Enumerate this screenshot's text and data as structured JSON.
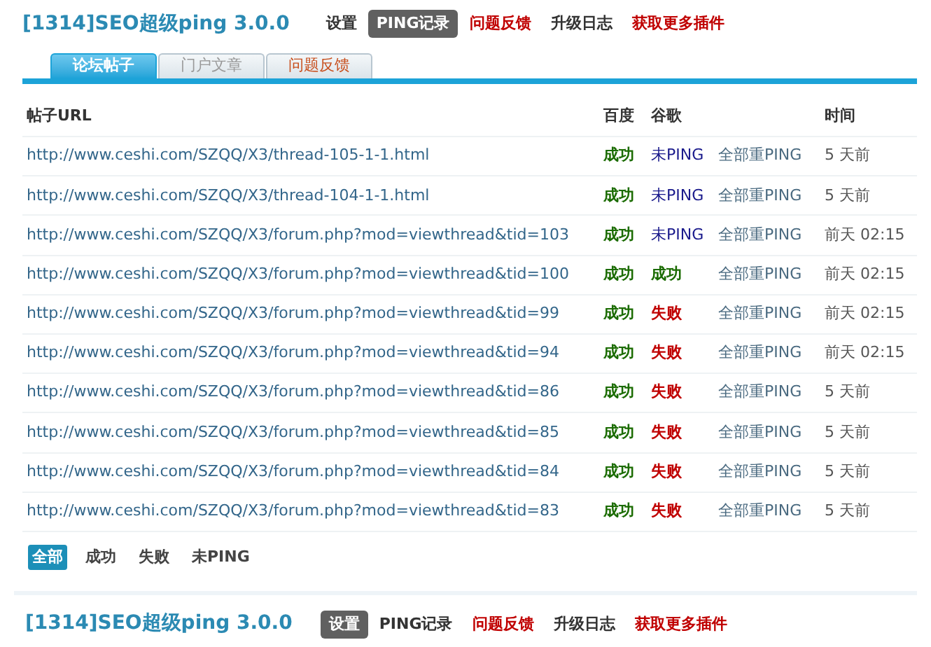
{
  "header": {
    "title": "[1314]SEO超级ping 3.0.0",
    "nav": [
      {
        "label": "设置",
        "selected": false,
        "kind": "plain"
      },
      {
        "label": "PING记录",
        "selected": true,
        "kind": "plain"
      },
      {
        "label": "问题反馈",
        "selected": false,
        "kind": "alert"
      },
      {
        "label": "升级日志",
        "selected": false,
        "kind": "plain"
      },
      {
        "label": "获取更多插件",
        "selected": false,
        "kind": "alert"
      }
    ]
  },
  "tabs": [
    {
      "label": "论坛帖子",
      "selected": true,
      "kind": "plain"
    },
    {
      "label": "门户文章",
      "selected": false,
      "kind": "plain"
    },
    {
      "label": "问题反馈",
      "selected": false,
      "kind": "alert"
    }
  ],
  "table": {
    "columns": [
      "帖子URL",
      "百度",
      "谷歌",
      "时间"
    ],
    "rows": [
      {
        "url": "http://www.ceshi.com/SZQQ/X3/thread-105-1-1.html",
        "baidu": {
          "text": "成功",
          "kind": "success"
        },
        "google": {
          "text": "未PING",
          "kind": "none"
        },
        "action": "全部重PING",
        "time": "5 天前"
      },
      {
        "url": "http://www.ceshi.com/SZQQ/X3/thread-104-1-1.html",
        "baidu": {
          "text": "成功",
          "kind": "success"
        },
        "google": {
          "text": "未PING",
          "kind": "none"
        },
        "action": "全部重PING",
        "time": "5 天前"
      },
      {
        "url": "http://www.ceshi.com/SZQQ/X3/forum.php?mod=viewthread&tid=103",
        "baidu": {
          "text": "成功",
          "kind": "success"
        },
        "google": {
          "text": "未PING",
          "kind": "none"
        },
        "action": "全部重PING",
        "time": "前天 02:15"
      },
      {
        "url": "http://www.ceshi.com/SZQQ/X3/forum.php?mod=viewthread&tid=100",
        "baidu": {
          "text": "成功",
          "kind": "success"
        },
        "google": {
          "text": "成功",
          "kind": "success"
        },
        "action": "全部重PING",
        "time": "前天 02:15"
      },
      {
        "url": "http://www.ceshi.com/SZQQ/X3/forum.php?mod=viewthread&tid=99",
        "baidu": {
          "text": "成功",
          "kind": "success"
        },
        "google": {
          "text": "失败",
          "kind": "fail"
        },
        "action": "全部重PING",
        "time": "前天 02:15"
      },
      {
        "url": "http://www.ceshi.com/SZQQ/X3/forum.php?mod=viewthread&tid=94",
        "baidu": {
          "text": "成功",
          "kind": "success"
        },
        "google": {
          "text": "失败",
          "kind": "fail"
        },
        "action": "全部重PING",
        "time": "前天 02:15"
      },
      {
        "url": "http://www.ceshi.com/SZQQ/X3/forum.php?mod=viewthread&tid=86",
        "baidu": {
          "text": "成功",
          "kind": "success"
        },
        "google": {
          "text": "失败",
          "kind": "fail"
        },
        "action": "全部重PING",
        "time": "5 天前"
      },
      {
        "url": "http://www.ceshi.com/SZQQ/X3/forum.php?mod=viewthread&tid=85",
        "baidu": {
          "text": "成功",
          "kind": "success"
        },
        "google": {
          "text": "失败",
          "kind": "fail"
        },
        "action": "全部重PING",
        "time": "5 天前"
      },
      {
        "url": "http://www.ceshi.com/SZQQ/X3/forum.php?mod=viewthread&tid=84",
        "baidu": {
          "text": "成功",
          "kind": "success"
        },
        "google": {
          "text": "失败",
          "kind": "fail"
        },
        "action": "全部重PING",
        "time": "5 天前"
      },
      {
        "url": "http://www.ceshi.com/SZQQ/X3/forum.php?mod=viewthread&tid=83",
        "baidu": {
          "text": "成功",
          "kind": "success"
        },
        "google": {
          "text": "失败",
          "kind": "fail"
        },
        "action": "全部重PING",
        "time": "5 天前"
      }
    ]
  },
  "filters": [
    {
      "label": "全部",
      "selected": true
    },
    {
      "label": "成功",
      "selected": false
    },
    {
      "label": "失败",
      "selected": false
    },
    {
      "label": "未PING",
      "selected": false
    }
  ],
  "footer_header": {
    "title": "[1314]SEO超级ping 3.0.0",
    "nav": [
      {
        "label": "设置",
        "selected": true,
        "kind": "plain"
      },
      {
        "label": "PING记录",
        "selected": false,
        "kind": "plain"
      },
      {
        "label": "问题反馈",
        "selected": false,
        "kind": "alert"
      },
      {
        "label": "升级日志",
        "selected": false,
        "kind": "plain"
      },
      {
        "label": "获取更多插件",
        "selected": false,
        "kind": "alert"
      }
    ]
  }
}
